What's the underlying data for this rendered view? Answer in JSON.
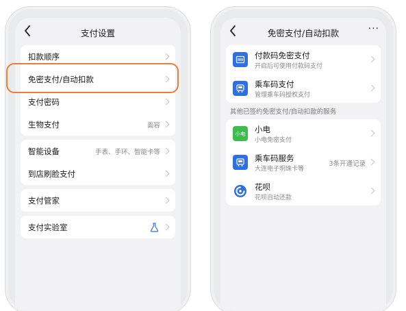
{
  "left": {
    "nav_title": "支付设置",
    "items_group1": [
      {
        "label": "扣款顺序",
        "value": ""
      },
      {
        "label": "免密支付/自动扣款",
        "value": ""
      },
      {
        "label": "支付密码",
        "value": ""
      },
      {
        "label": "生物支付",
        "value": "面容"
      }
    ],
    "items_group2": [
      {
        "label": "智能设备",
        "value": "手表、手环、智能卡等"
      },
      {
        "label": "到店刷脸支付",
        "value": ""
      }
    ],
    "item_manager": {
      "label": "支付管家"
    },
    "item_lab": {
      "label": "支付实验室"
    }
  },
  "right": {
    "nav_title": "免密支付/自动扣款",
    "more_label": "···",
    "top_items": [
      {
        "title": "付款码免密支付",
        "sub": "开启后可使用付款码支付",
        "icon": "payment-code-icon"
      },
      {
        "title": "乘车码支付",
        "sub": "管理乘车码授权支付",
        "icon": "transit-code-icon"
      }
    ],
    "section_title": "其他已签约免密支付/自动扣款的服务",
    "services": [
      {
        "title": "小电",
        "sub": "小电免密支付",
        "value": "",
        "icon_text": "小电"
      },
      {
        "title": "乘车码服务",
        "sub": "大连电子明珠卡等",
        "value": "3条开通记录",
        "icon": "transit-code-icon"
      },
      {
        "title": "花呗",
        "sub": "花呗自动还款",
        "value": "",
        "icon": "huabei-icon"
      }
    ]
  },
  "colors": {
    "highlight": "#ec7b3c",
    "brand_blue": "#2f6fe0",
    "green": "#3dbb4f"
  }
}
